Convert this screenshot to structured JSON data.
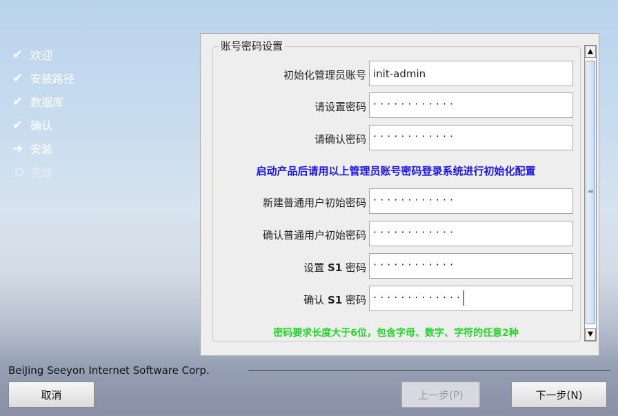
{
  "steps": [
    {
      "icon": "check-icon",
      "glyph": "✔",
      "label": "欢迎",
      "state": "done"
    },
    {
      "icon": "check-icon",
      "glyph": "✔",
      "label": "安装路径",
      "state": "done"
    },
    {
      "icon": "check-icon",
      "glyph": "✔",
      "label": "数据库",
      "state": "done"
    },
    {
      "icon": "check-icon",
      "glyph": "✔",
      "label": "确认",
      "state": "done"
    },
    {
      "icon": "arrow-right-icon",
      "glyph": "➔",
      "label": "安装",
      "state": "current"
    },
    {
      "icon": "circle-icon",
      "glyph": "○",
      "label": "完成",
      "state": "pending"
    }
  ],
  "form": {
    "group_title": "账号密码设置",
    "admin_label": "初始化管理员账号",
    "admin_value": "init-admin",
    "pw_label": "请设置密码",
    "pw_value": "············",
    "pw_confirm_label": "请确认密码",
    "pw_confirm_value": "············",
    "blue_note": "启动产品后请用以上管理员账号密码登录系统进行初始化配置",
    "user_pw_label": "新建普通用户初始密码",
    "user_pw_value": "············",
    "user_pw_confirm_label": "确认普通用户初始密码",
    "user_pw_confirm_value": "············",
    "s1_pw_label_pre": "设置 ",
    "s1_pw_label_bold": "S1",
    "s1_pw_label_post": " 密码",
    "s1_pw_value": "············",
    "s1_confirm_label_pre": "确认 ",
    "s1_confirm_label_bold": "S1",
    "s1_confirm_label_post": " 密码",
    "s1_confirm_value": "·············",
    "green_note": "密码要求长度大于6位，包含字母、数字、字符的任意2种"
  },
  "footer": {
    "company": "BeiJing Seeyon Internet Software Corp.",
    "cancel": "取消",
    "prev": "上一步(P)",
    "next": "下一步(N)"
  },
  "colors": {
    "note_blue": "#1a14ea",
    "note_green": "#25d52a"
  }
}
